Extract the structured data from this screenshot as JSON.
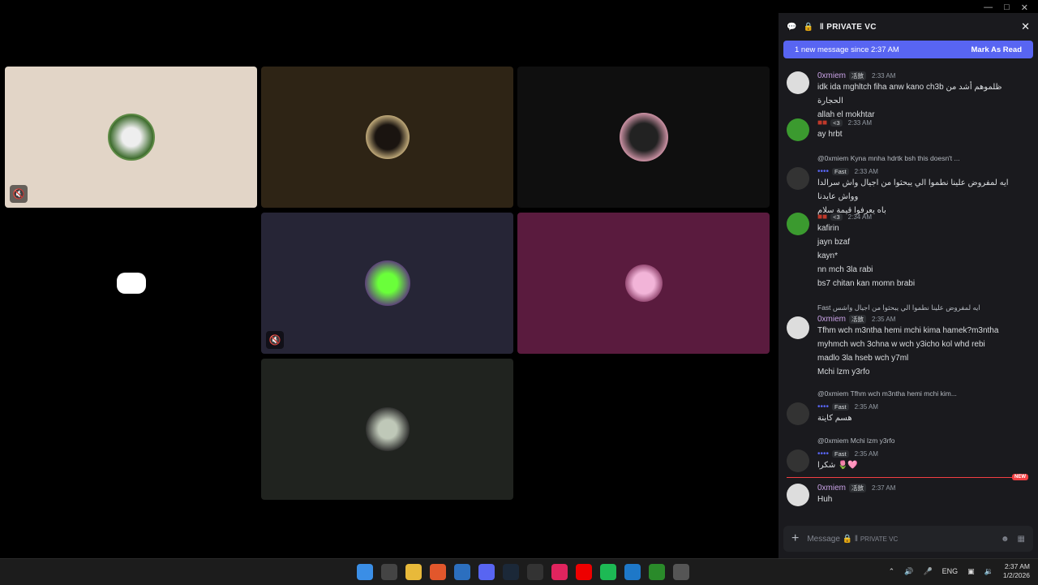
{
  "header": {
    "channel_name": "PRIVATE VC"
  },
  "banner": {
    "text": "1 new message since 2:37 AM",
    "action": "Mark As Read"
  },
  "tag_label": "㓉敳",
  "messages": [
    {
      "name": "0xmiem",
      "time": "2:33 AM",
      "lines": [
        "idk ida mghltch fiha anw kano ch3b ظلموهم أشد من الحجارة",
        "allah el mokhtar"
      ]
    },
    {
      "name": "",
      "tag": "<3",
      "time": "2:33 AM",
      "lines": [
        "ay hrbt"
      ]
    },
    {
      "reply": "@0xmiem  Kyna mnha hdrtk bsh this doesn't ...",
      "tag": "Fast",
      "time": "2:33 AM",
      "lines": [
        "ايه لمفروض علينا نطموا الي يبحثوا من اجيال واش سرالدا وواش عايدنا",
        "باه يعرفوا قيمة سلام"
      ]
    },
    {
      "name": "",
      "tag": "<3",
      "time": "2:34 AM",
      "lines": [
        "kafirin",
        "jayn bzaf",
        "kayn*",
        "nn mch 3la rabi",
        "bs7 chitan kan momn brabi"
      ]
    },
    {
      "reply": "Fast  ايه لمفروض علينا نطموا الي يبحثوا من اجيال واشس",
      "name": "0xmiem",
      "time": "2:35 AM",
      "lines": [
        "Tfhm wch m3ntha hemi mchi kima hamek?m3ntha",
        "myhmch wch 3chna w wch y3icho kol whd rebi",
        "madlo 3la hseb wch y7ml",
        "Mchi lzm y3rfo"
      ]
    },
    {
      "reply": "@0xmiem  Tfhm wch m3ntha hemi mchi kim...",
      "tag": "Fast",
      "time": "2:35 AM",
      "lines": [
        "هسم كاينة"
      ]
    },
    {
      "reply": "@0xmiem  Mchi lzm y3rfo",
      "tag": "Fast",
      "time": "2:35 AM",
      "lines": [
        "شكرا 🌷🩷"
      ]
    },
    {
      "name": "0xmiem",
      "time": "2:37 AM",
      "lines": [
        "Huh"
      ]
    }
  ],
  "new_label": "NEW",
  "composer": {
    "placeholder": "Message",
    "channel": "PRIVATE VC"
  },
  "taskbar": {
    "lang": "ENG",
    "time": "2:37 AM",
    "date": "1/2/2026"
  },
  "colors": {
    "accent": "#5865f2",
    "panel": "#1a1a1e",
    "new": "#f23f43"
  }
}
